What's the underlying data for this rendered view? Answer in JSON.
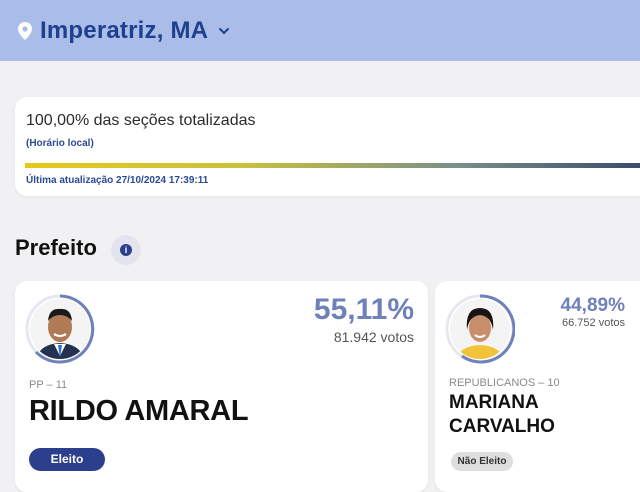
{
  "header": {
    "location_icon": "map-pin-icon",
    "city": "Imperatriz, MA",
    "dropdown_icon": "chevron-down-icon"
  },
  "status": {
    "sections_totalized": "100,00% das seções totalizadas",
    "local_time_note": "(Horário local)",
    "progress": 1.0,
    "last_update": "Última atualização 27/10/2024 17:39:11"
  },
  "section": {
    "title": "Prefeito",
    "info_icon": "info-icon"
  },
  "candidates": [
    {
      "party": "PP – 11",
      "name": "RILDO AMARAL",
      "percent": "55,11%",
      "votes": "81.942 votos",
      "status": "Eleito"
    },
    {
      "party": "REPUBLICANOS – 10",
      "name": "MARIANA CARVALHO",
      "percent": "44,89%",
      "votes": "66.752 votos",
      "status": "Não Eleito"
    }
  ],
  "colors": {
    "header_bg": "#a9bde8",
    "brand_blue": "#2c3f8c",
    "percent_color": "#6e81b8"
  }
}
